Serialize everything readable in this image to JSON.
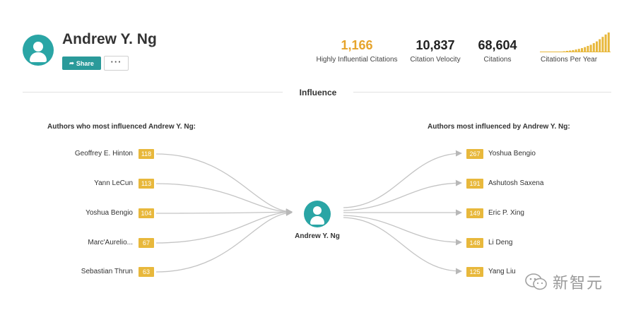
{
  "profile": {
    "name": "Andrew Y. Ng",
    "share_label": "Share",
    "more_label": "···"
  },
  "stats": {
    "highly_influential": {
      "value": "1,166",
      "label": "Highly Influential Citations",
      "color": "#e6a42c"
    },
    "velocity": {
      "value": "10,837",
      "label": "Citation Velocity"
    },
    "citations": {
      "value": "68,604",
      "label": "Citations"
    },
    "per_year": {
      "label": "Citations Per Year",
      "bars": [
        0.05,
        0.07,
        0.09,
        0.11,
        0.14,
        0.17,
        0.21,
        0.26,
        0.32,
        0.38,
        0.46,
        0.55,
        0.66,
        0.78,
        0.9,
        1.0
      ],
      "color": "#e8b83c"
    }
  },
  "influence": {
    "heading": "Influence",
    "center_name": "Andrew Y. Ng",
    "left_heading": "Authors who most influenced Andrew Y. Ng:",
    "right_heading": "Authors most influenced by Andrew Y. Ng:",
    "influencers": [
      {
        "name": "Geoffrey E. Hinton",
        "count": "118"
      },
      {
        "name": "Yann LeCun",
        "count": "113"
      },
      {
        "name": "Yoshua Bengio",
        "count": "104"
      },
      {
        "name": "Marc'Aurelio...",
        "count": "67"
      },
      {
        "name": "Sebastian Thrun",
        "count": "63"
      }
    ],
    "influenced": [
      {
        "name": "Yoshua Bengio",
        "count": "267"
      },
      {
        "name": "Ashutosh Saxena",
        "count": "191"
      },
      {
        "name": "Eric P. Xing",
        "count": "149"
      },
      {
        "name": "Li Deng",
        "count": "148"
      },
      {
        "name": "Yang Liu",
        "count": "125"
      }
    ],
    "badge_color": "#e8b83c",
    "accent": "#2aa5a5"
  },
  "watermark": {
    "text": "新智元"
  }
}
